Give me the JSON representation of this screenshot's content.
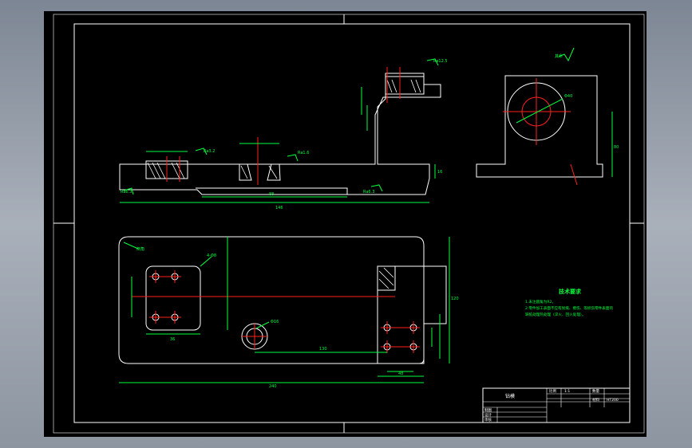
{
  "colors": {
    "outline": "#ffffff",
    "dimension": "#00ff3c",
    "centerline": "#ff2020",
    "hatch": "#ffffff",
    "note": "#00ff3c",
    "background": "#000000"
  },
  "front_view": {
    "dim_total_length": "146",
    "dim_slot_length": "88",
    "dim_height": "16",
    "roughness_labels": [
      "Ra6.3",
      "Ra3.2",
      "Ra12.5",
      "Ra6.3",
      "Ra1.6"
    ]
  },
  "side_view": {
    "dim_height": "80",
    "dim_bore": "Φ40",
    "roughness_note": "其余"
  },
  "top_view": {
    "dim_total_length": "240",
    "dim_total_width": "120",
    "dim_offset": "130",
    "dim_boss_diameter": "Φ16",
    "dim_hole_spacing": "36",
    "dim_right_width": "48",
    "leader_left": "倒角",
    "leader_mid": "4-Φ8"
  },
  "tech_requirements": {
    "title": "技术要求",
    "lines": [
      "1.未注圆角为R2。",
      "2.零件加工表面不应有划痕、擦伤、等损伤零件表面的",
      "缺陷处理热处理（淬火、回火处理）。"
    ]
  },
  "title_block": {
    "part_name": "钻模",
    "scale_label": "比例",
    "scale_value": "1:1",
    "qty_label": "数量",
    "material_label": "材料",
    "material_value": "HT200",
    "drawn_label": "制图",
    "design_label": "设计",
    "check_label": "审核"
  }
}
